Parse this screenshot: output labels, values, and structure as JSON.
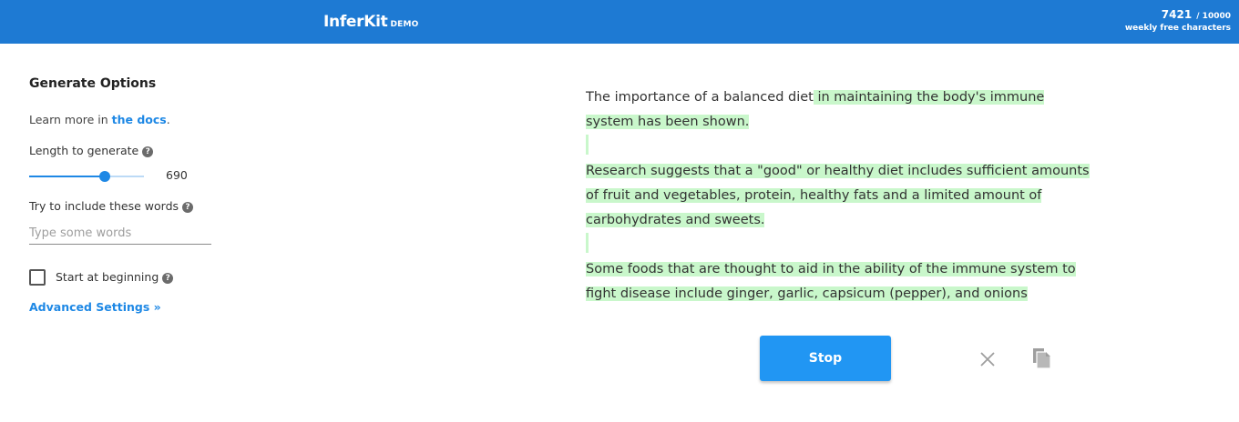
{
  "header": {
    "brand": "InferKit",
    "brand_suffix": "DEMO",
    "quota_used": "7421",
    "quota_limit": "/ 10000",
    "quota_caption": "weekly free characters"
  },
  "options": {
    "heading": "Generate Options",
    "learn_prefix": "Learn more in ",
    "docs_link": "the docs",
    "learn_suffix": ".",
    "length_label": "Length to generate",
    "length_value": "690",
    "length_fraction": 0.66,
    "words_label": "Try to include these words",
    "words_placeholder": "Type some words",
    "words_value": "",
    "start_label": "Start at beginning",
    "start_checked": false,
    "advanced_label": "Advanced Settings »",
    "help_glyph": "?"
  },
  "editor": {
    "prompt": "The importance of a balanced diet",
    "generated_1": " in maintaining the body's immune system has been shown.",
    "generated_2": "Research suggests that a \"good\" or healthy diet includes sufficient amounts of fruit and vegetables, protein, healthy fats and a limited amount of carbohydrates and sweets.",
    "generated_3": "Some foods that are thought to aid in the ability of the immune system to fight disease include ginger, garlic, capsicum (pepper), and onions",
    "highlight_color": "#c9f7cb"
  },
  "actions": {
    "stop_label": "Stop",
    "clear_icon": "close-icon",
    "copy_icon": "copy-icon"
  },
  "colors": {
    "topbar": "#1e7ad3",
    "accent": "#1e88e5",
    "button": "#2196f3"
  }
}
